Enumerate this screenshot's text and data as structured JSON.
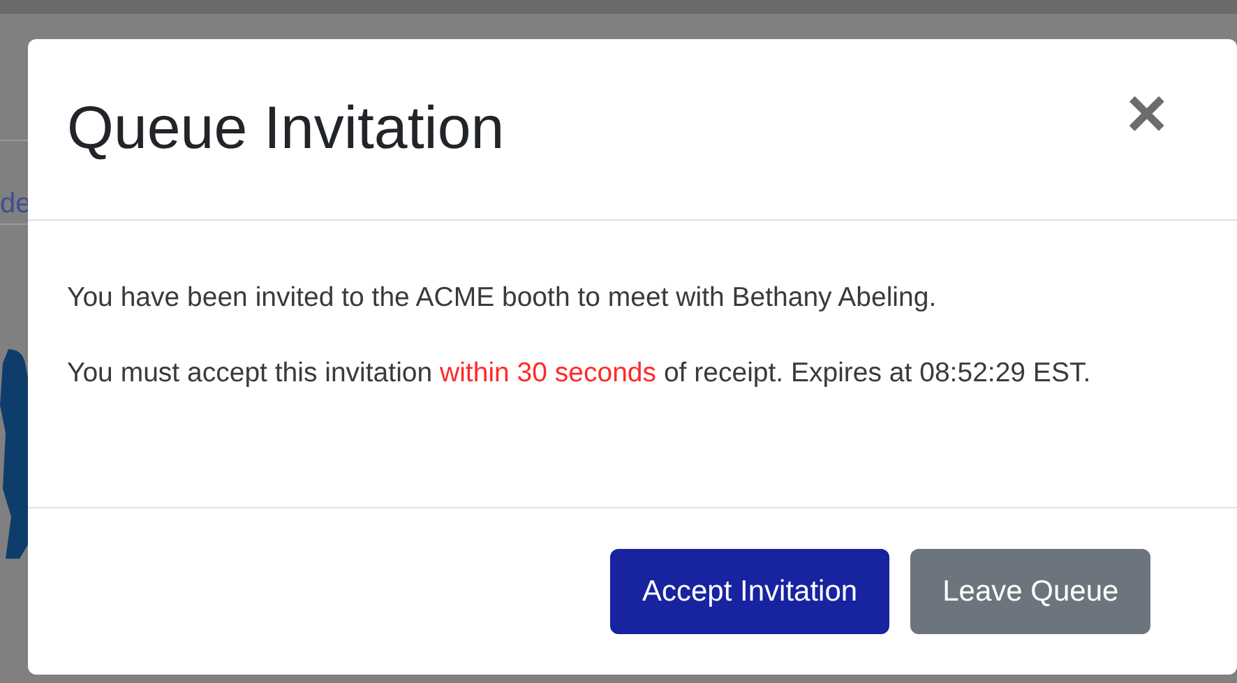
{
  "background": {
    "fragment_text": "de"
  },
  "modal": {
    "title": "Queue Invitation",
    "close": "×",
    "paragraphs": [
      {
        "text": "You have been invited to the ACME booth to meet with Bethany Abeling."
      },
      {
        "text": "You must accept this invitation **within 30 seconds** of receipt. Expires at 08:52:29 EST."
      }
    ],
    "buttons": [
      {
        "label": "Accept Invitation",
        "kind": "primary"
      },
      {
        "label": "Leave Queue",
        "kind": "secondary"
      }
    ]
  }
}
